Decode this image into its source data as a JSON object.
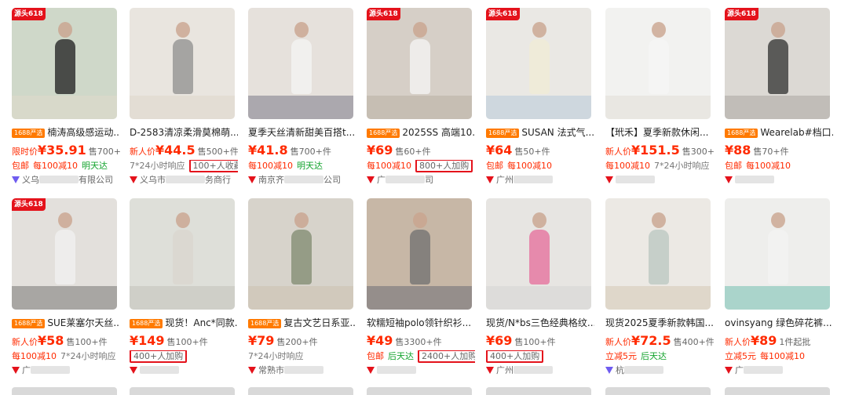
{
  "badge_text": "源头618",
  "tag_1688": "1688严选",
  "cards": [
    {
      "title": "楠涛高级感运动...",
      "price_label": "限时价",
      "price": "¥35.91",
      "sold": "售700+件",
      "promo": [
        [
          "red",
          "包邮"
        ],
        [
          "red",
          "每100减10"
        ],
        [
          "green",
          "明天达"
        ]
      ],
      "seller": "义乌",
      "seller_end": "有限公司"
    },
    {
      "title": "D-2583清凉柔滑莫棉萌...",
      "price_label": "新人价",
      "price": "¥44.5",
      "sold": "售500+件",
      "promo": [
        [
          "gray",
          "7*24小时响应"
        ],
        [
          "boxed",
          "100+人收藏"
        ]
      ],
      "seller": "义乌市",
      "seller_end": "务商行"
    },
    {
      "title": "夏季天丝清新甜美百搭t...",
      "price_label": "",
      "price": "¥41.8",
      "sold": "售700+件",
      "promo": [
        [
          "red",
          "每100减10"
        ],
        [
          "green",
          "明天达"
        ]
      ],
      "seller": "南京齐",
      "seller_end": "公司"
    },
    {
      "title": "2025SS 高端10...",
      "price_label": "",
      "price": "¥69",
      "sold": "售60+件",
      "promo": [
        [
          "red",
          "每100减10"
        ],
        [
          "boxed",
          "800+人加购"
        ]
      ],
      "seller": "广",
      "seller_end": "司"
    },
    {
      "title": "SUSAN 法式气...",
      "price_label": "",
      "price": "¥64",
      "sold": "售50+件",
      "promo": [
        [
          "red",
          "包邮"
        ],
        [
          "red",
          "每100减10"
        ]
      ],
      "seller": "广州",
      "seller_end": ""
    },
    {
      "title": "【玳禾】夏季新款休闲...",
      "price_label": "新人价",
      "price": "¥151.5",
      "sold": "售300+件",
      "promo": [
        [
          "red",
          "每100减10"
        ],
        [
          "gray",
          "7*24小时响应"
        ]
      ],
      "seller": "",
      "seller_end": ""
    },
    {
      "title": "Wearelab#档口...",
      "price_label": "",
      "price": "¥88",
      "sold": "售70+件",
      "promo": [
        [
          "red",
          "包邮"
        ],
        [
          "red",
          "每100减10"
        ]
      ],
      "seller": "",
      "seller_end": ""
    },
    {
      "title": "SUE莱塞尔天丝...",
      "price_label": "新人价",
      "price": "¥58",
      "sold": "售100+件",
      "promo": [
        [
          "red",
          "每100减10"
        ],
        [
          "gray",
          "7*24小时响应"
        ]
      ],
      "seller": "广",
      "seller_end": ""
    },
    {
      "title": "现货！Anc*同款...",
      "price_label": "",
      "price": "¥149",
      "sold": "售100+件",
      "promo": [
        [
          "boxed",
          "400+人加购"
        ]
      ],
      "seller": "",
      "seller_end": ""
    },
    {
      "title": "复古文艺日系亚...",
      "price_label": "",
      "price": "¥79",
      "sold": "售200+件",
      "promo": [
        [
          "gray",
          "7*24小时响应"
        ]
      ],
      "seller": "常熟市",
      "seller_end": ""
    },
    {
      "title": "软糯短袖polo领针织衫...",
      "price_label": "",
      "price": "¥49",
      "sold": "售3300+件",
      "promo": [
        [
          "red",
          "包邮"
        ],
        [
          "green",
          "后天达"
        ],
        [
          "boxed",
          "2400+人加购"
        ]
      ],
      "seller": "",
      "seller_end": ""
    },
    {
      "title": "现货/N*bs三色经典格纹...",
      "price_label": "",
      "price": "¥69",
      "sold": "售100+件",
      "promo": [
        [
          "boxed",
          "400+人加购"
        ]
      ],
      "seller": "广州",
      "seller_end": ""
    },
    {
      "title": "现货2025夏季新款韩国...",
      "price_label": "新人价",
      "price": "¥72.5",
      "sold": "售400+件",
      "promo": [
        [
          "red",
          "立减5元"
        ],
        [
          "green",
          "后天达"
        ]
      ],
      "seller": "杭",
      "seller_end": ""
    },
    {
      "title": "ovinsyang 绿色碎花裤...",
      "price_label": "新人价",
      "price": "¥89",
      "sold": "1件起批",
      "promo": [
        [
          "red",
          "立减5元"
        ],
        [
          "red",
          "每100减10"
        ]
      ],
      "seller": "广",
      "seller_end": ""
    }
  ]
}
